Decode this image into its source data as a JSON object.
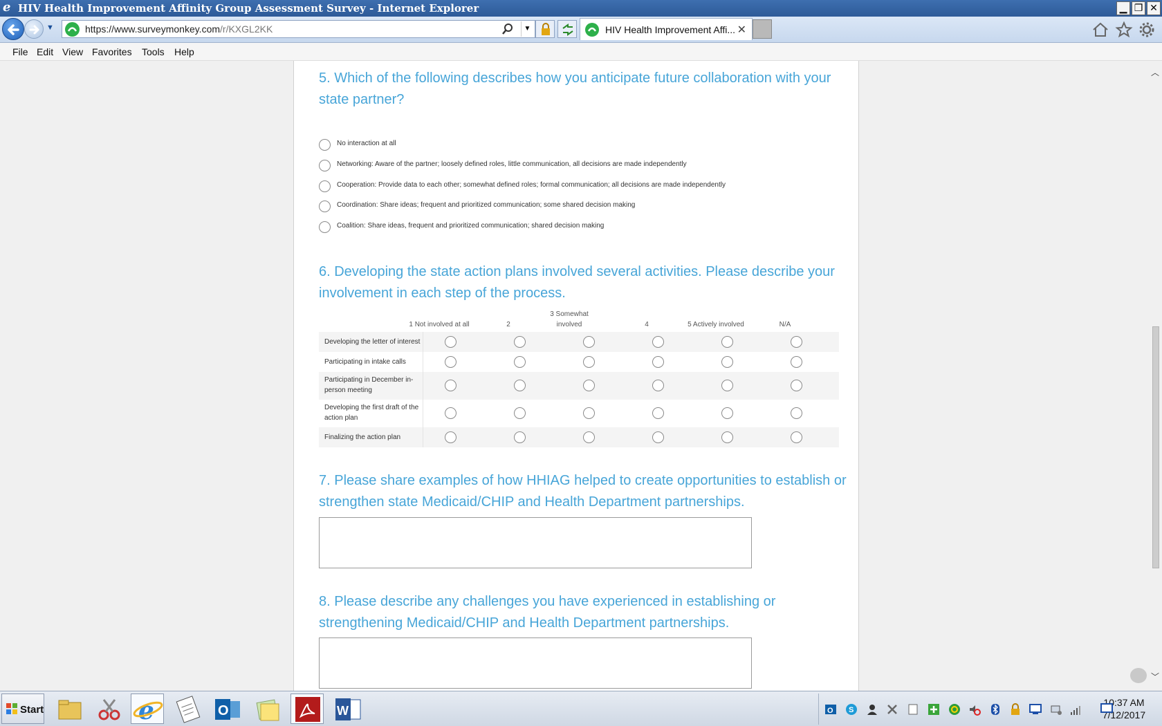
{
  "window": {
    "title": "HIV Health Improvement Affinity Group Assessment Survey - Internet Explorer",
    "minimize_glyph": "▁",
    "restore_glyph": "❐",
    "close_glyph": "✕"
  },
  "browser": {
    "url_prefix": "https://www.surveymonkey.com",
    "url_rest": "/r/KXGL2KK",
    "tab_label": "HIV Health Improvement Affi...",
    "tab_close": "✕"
  },
  "menu": [
    "File",
    "Edit",
    "View",
    "Favorites",
    "Tools",
    "Help"
  ],
  "survey": {
    "q5": {
      "title": "5. Which of the following describes how you anticipate future collaboration with your state partner?",
      "options": [
        "No interaction at all",
        "Networking: Aware of the partner; loosely defined roles, little communication, all decisions are made independently",
        "Cooperation: Provide data to each other; somewhat defined roles; formal communication; all decisions are made independently",
        "Coordination: Share ideas; frequent and prioritized communication; some shared decision making",
        "Coalition: Share ideas, frequent and prioritized communication; shared decision making"
      ]
    },
    "q6": {
      "title": "6. Developing the state action plans involved several activities. Please describe your involvement in each step of the process.",
      "columns": [
        "1 Not involved at all",
        "2",
        "3 Somewhat involved",
        "4",
        "5 Actively involved",
        "N/A"
      ],
      "rows": [
        "Developing the letter of interest",
        "Participating in intake calls",
        "Participating in December in-person meeting",
        "Developing the first draft of the action plan",
        "Finalizing the action plan"
      ]
    },
    "q7": {
      "title": "7. Please share examples of how HHIAG helped to create opportunities to establish or strengthen state Medicaid/CHIP and Health Department partnerships."
    },
    "q8": {
      "title": "8. Please describe any challenges you have experienced in establishing or strengthening Medicaid/CHIP and Health Department partnerships."
    }
  },
  "taskbar": {
    "start_label": "Start",
    "time": "10:37 AM",
    "date": "7/12/2017"
  },
  "colors": {
    "question_blue": "#47a5d8",
    "titlebar_blue": "#2d5a98",
    "surveymonkey_green": "#2db04a"
  }
}
